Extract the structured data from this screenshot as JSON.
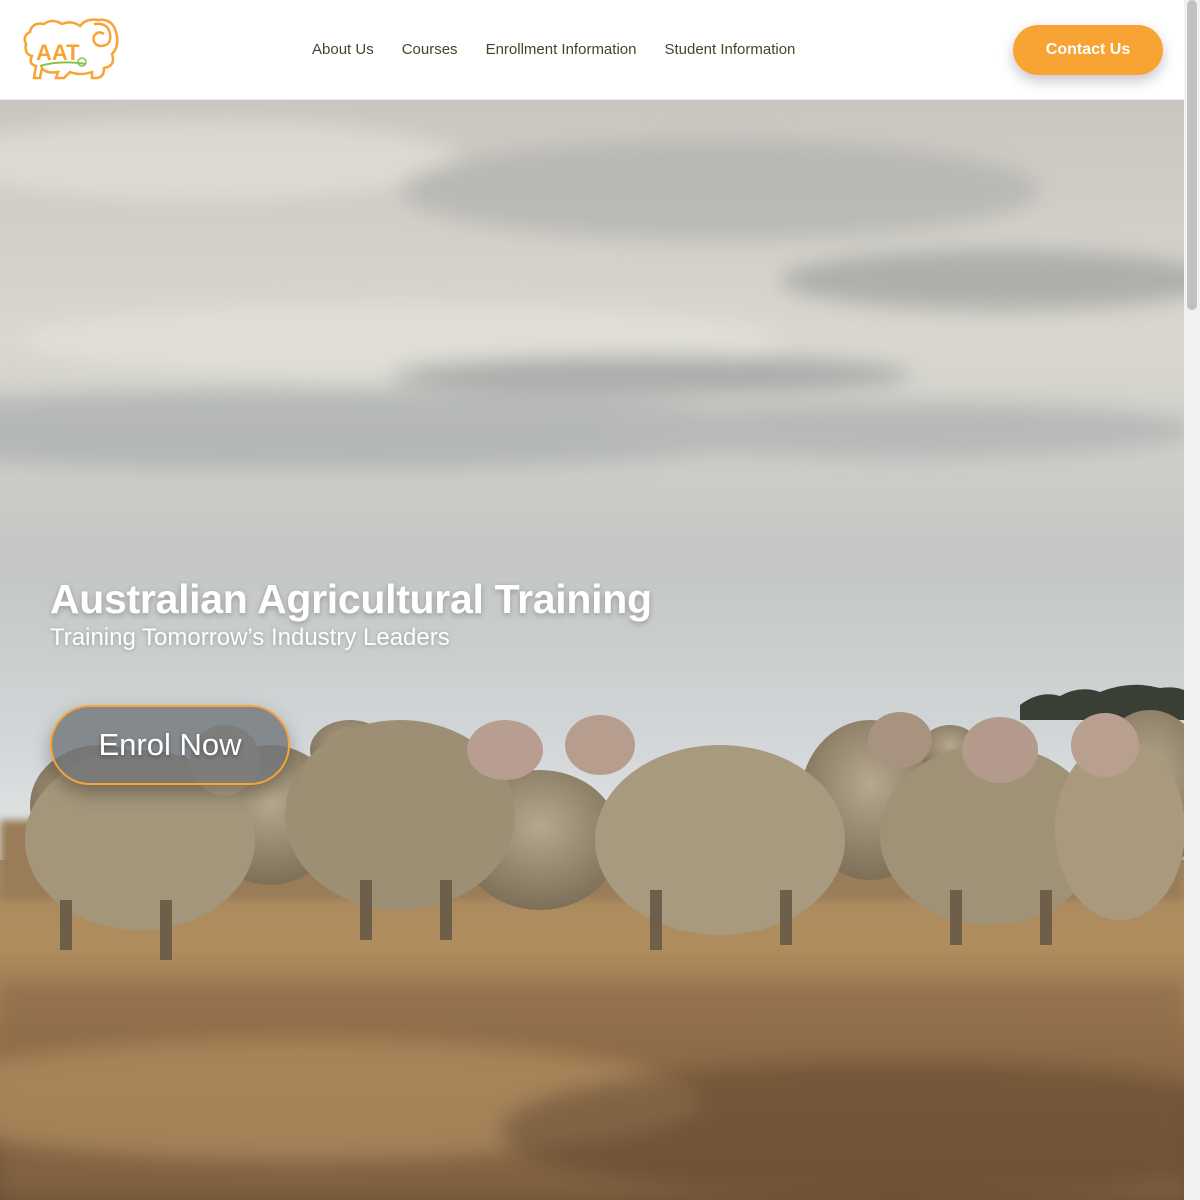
{
  "header": {
    "logo_text": "AAT",
    "nav": [
      {
        "label": "About Us"
      },
      {
        "label": "Courses"
      },
      {
        "label": "Enrollment Information"
      },
      {
        "label": "Student Information"
      }
    ],
    "contact_label": "Contact Us"
  },
  "hero": {
    "title": "Australian Agricultural Training",
    "subtitle": "Training Tomorrow’s Industry Leaders",
    "enrol_label": "Enrol Now",
    "background": "sheep-in-field-photo"
  },
  "colors": {
    "accent": "#f8a434",
    "nav_text": "#3d4a2a",
    "logo_green": "#8bc34a"
  }
}
